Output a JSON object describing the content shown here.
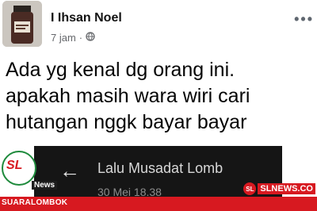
{
  "post": {
    "author": "I Ihsan Noel",
    "time": "7 jam",
    "separator": "·",
    "audience_icon": "globe-icon",
    "more_icon": "more-options-icon",
    "text": "Ada yg kenal dg orang ini.\napakah masih wara wiri cari\nhutangan nggk bayar bayar"
  },
  "embed": {
    "back_icon": "back-arrow-icon",
    "contact_name": "Lalu Musadat Lomb",
    "contact_sub": "30 Mei 18.38"
  },
  "watermarks": {
    "left_logo": "SL",
    "left_news": "News",
    "left_caption": "SUARALOMBOK",
    "right_logo": "SL",
    "right_text": "SLNEWS.CO"
  },
  "colors": {
    "accent_red": "#d71920",
    "embed_bg": "#151515"
  }
}
